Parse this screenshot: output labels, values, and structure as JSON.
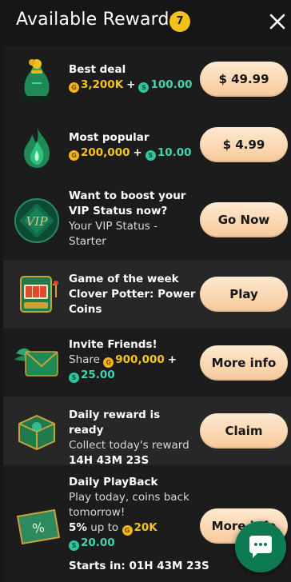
{
  "header": {
    "title": "Available Rewards",
    "badge_count": "7",
    "close_icon": "close-icon"
  },
  "rewards": [
    {
      "title": "Best deal",
      "gold_amount": "3,200K",
      "sweep_amount": "100.00",
      "plus": "+",
      "button": "$ 49.99",
      "icon": "money-bag-icon"
    },
    {
      "title": "Most popular",
      "gold_amount": "200,000",
      "sweep_amount": "10.00",
      "plus": "+",
      "button": "$ 4.99",
      "icon": "flame-icon"
    },
    {
      "title": "Want to boost your VIP Status now?",
      "subtitle": "Your VIP Status - Starter",
      "button": "Go Now",
      "icon": "vip-gem-icon"
    },
    {
      "title": "Game of the week Clover Potter: Power Coins",
      "button": "Play",
      "icon": "slot-machine-icon"
    },
    {
      "title": "Invite Friends!",
      "share_label": "Share",
      "gold_amount": "900,000",
      "plus": "+",
      "sweep_amount": "25.00",
      "button": "More info",
      "icon": "winged-envelope-icon"
    },
    {
      "title": "Daily reward is ready",
      "subtitle": "Collect today's reward",
      "timer": "14H 43M 23S",
      "button": "Claim",
      "icon": "gift-box-icon"
    },
    {
      "title": "Daily PlayBack",
      "subtitle": "Play today, coins back tomorrow!",
      "percent": "5%",
      "up_to": "up to",
      "gold_amount": "20K",
      "sweep_amount": "20.00",
      "starts_label": "Starts in: 01H 43M 23S",
      "button": "More info",
      "icon": "percent-ticket-icon"
    }
  ],
  "chat": {
    "icon": "chat-bubble-icon"
  },
  "colors": {
    "accent_gold": "#f2c21b",
    "sweep_green": "#3fd4ae",
    "button_peach": "#f7c99b",
    "chat_green": "#0e7a52"
  }
}
